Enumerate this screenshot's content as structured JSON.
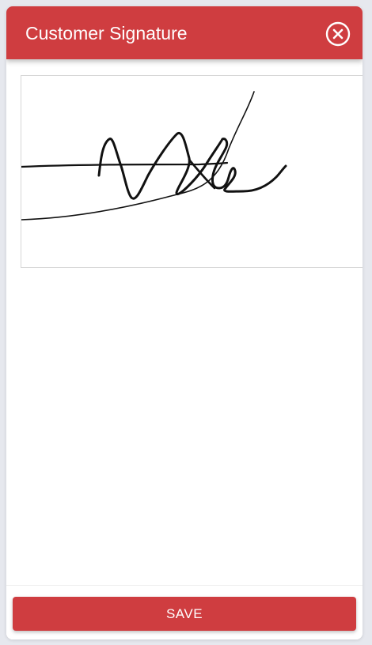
{
  "header": {
    "title": "Customer Signature",
    "close_icon": "close-circle-icon",
    "color": "#cf3d40"
  },
  "signature_pad": {
    "has_signature": true
  },
  "footer": {
    "save_label": "SAVE"
  }
}
